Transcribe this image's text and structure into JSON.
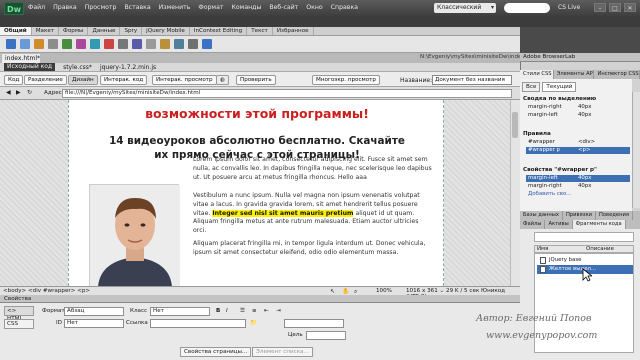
{
  "app": {
    "logo_text": "Dw",
    "workspace": "Классический",
    "cslive": "CS Live"
  },
  "menu": [
    "Файл",
    "Правка",
    "Просмотр",
    "Вставка",
    "Изменить",
    "Формат",
    "Команды",
    "Веб-сайт",
    "Окно",
    "Справка"
  ],
  "insert_tabs": [
    "Общий",
    "Макет",
    "Формы",
    "Данные",
    "Spry",
    "jQuery Mobile",
    "InContext Editing",
    "Текст",
    "Избранное"
  ],
  "document": {
    "tab": "index.html*",
    "path": "N:\\Evgeniy\\mySites\\minisiteDw\\index.html",
    "related_files": [
      "Исходный код",
      "style.css*",
      "jquery-1.7.2.min.js"
    ],
    "views": [
      "Код",
      "Разделение",
      "Дизайн",
      "Интерак. код",
      "Интерак. просмотр",
      "Проверить",
      "Многоэкр. просмотр"
    ],
    "title_label": "Название:",
    "title_value": "Документ без названия",
    "address_label": "Адрес:",
    "address_value": "file:///N|/Evgeniy/mySites/minisiteDw/index.html"
  },
  "page": {
    "headline": "возможности этой программы!",
    "subhead_line1": "14 видеоуроков абсолютно бесплатно. Скачайте",
    "subhead_line2": "их прямо сейчас с этой страницы!",
    "para1": "Lorem ipsum dolor sit amet, consectetur adipiscing elit. Fusce sit amet sem nulla, ac convallis leo. In dapibus fringilla neque, nec scelerisque leo dapibus ut. Ut posuere arcu at metus fringilla rhoncus. Hello aaa",
    "para2_start": "Vestibulum a nunc ipsum. Nulla vel magna non ipsum venenatis volutpat vitae a lacus. In gravida gravida lorem, sit amet hendrerit tellus posuere vitae. ",
    "para2_highlight": "Integer sed nisl sit amet mauris pretium",
    "para2_end": " aliquet id ut quam. Aliquam fringilla metus at ante rutrum malesuada. Etiam auctor ultricies orci.",
    "para3": "Aliquam placerat fringilla mi, in tempor ligula interdum ut. Donec vehicula, ipsum sit amet consectetur eleifend, odio odio elementum massa."
  },
  "statusbar": {
    "tags": "<body> <div #wrapper> <p>",
    "zoom": "100%",
    "info": "1016 x 361 ⌄ 29 K / 5 сек  Юникод (UTF-8)"
  },
  "properties": {
    "title": "Свойства",
    "html_btn": "<> HTML",
    "css_btn": "CSS",
    "format_label": "Формат",
    "format_value": "Абзац",
    "class_label": "Класс",
    "class_value": "Нет",
    "id_label": "ID",
    "id_value": "Нет",
    "link_label": "Ссылка",
    "target_label": "Цель",
    "page_props": "Свойства страницы...",
    "list_item": "Элемент списка..."
  },
  "right_panel": {
    "browserlab": "Adobe BrowserLab",
    "css_tabs": [
      "Стили CSS",
      "Элементы AP",
      "Инспектор CSS"
    ],
    "modes": [
      "Все",
      "Текущий"
    ],
    "summary_title": "Сводка по выделению",
    "summary_rows": [
      [
        "margin-right",
        "40px"
      ],
      [
        "margin-left",
        "40px"
      ]
    ],
    "rules_title": "Правила",
    "rules_rows": [
      [
        "#wrapper",
        "<div>"
      ],
      [
        "#wrapper p",
        "<p>"
      ]
    ],
    "props_title": "Свойства \"#wrapper p\"",
    "props_rows": [
      [
        "margin-left",
        "40px"
      ],
      [
        "margin-right",
        "40px"
      ],
      [
        "Добавить сво...",
        ""
      ]
    ],
    "db_tabs": [
      "Базы данных",
      "Привязки",
      "Поведения"
    ],
    "files_tabs": [
      "Файлы",
      "Активы",
      "Фрагменты кода"
    ],
    "snip_cols": [
      "Имя",
      "Описание"
    ],
    "snippets": [
      "jQuery base",
      "Желтое выдел..."
    ]
  },
  "watermark": {
    "author": "Автор: Евгений Попов",
    "site": "www.evgenypopov.com"
  }
}
